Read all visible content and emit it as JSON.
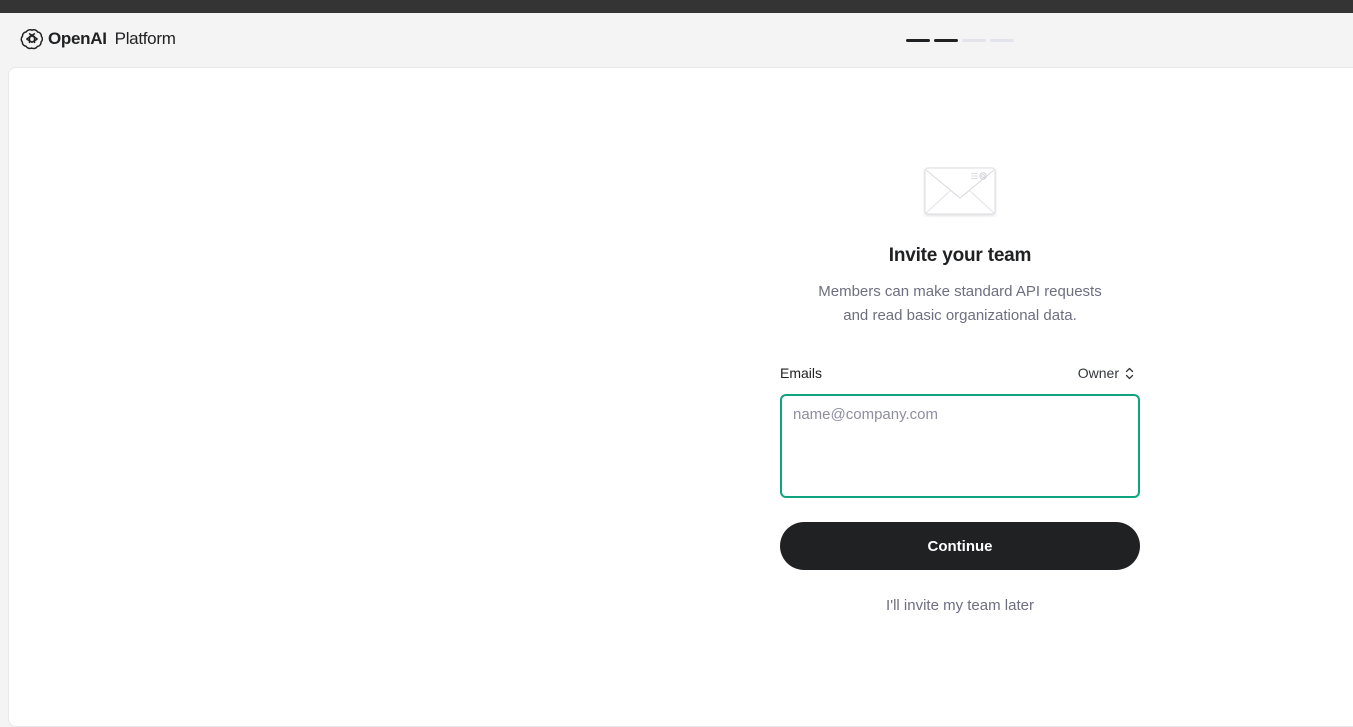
{
  "header": {
    "brand_name": "OpenAI",
    "brand_product": "Platform",
    "logo_icon": "openai-logo-icon",
    "steps": [
      {
        "state": "done"
      },
      {
        "state": "done"
      },
      {
        "state": "pending"
      },
      {
        "state": "pending"
      }
    ],
    "current_step": 2,
    "total_steps": 4
  },
  "invite": {
    "illustration_icon": "envelope-icon",
    "title": "Invite your team",
    "subtitle_line1": "Members can make standard API requests",
    "subtitle_line2": "and read basic organizational data.",
    "emails_label": "Emails",
    "role_value": "Owner",
    "role_icon": "chevron-updown-icon",
    "emails_placeholder": "name@company.com",
    "emails_value": "",
    "continue_label": "Continue",
    "later_label": "I'll invite my team later"
  },
  "colors": {
    "accent_border": "#10a37f",
    "primary_button": "#202123",
    "muted_text": "#6e6e80",
    "step_done": "#202123",
    "step_pending": "#e3e3ec"
  }
}
